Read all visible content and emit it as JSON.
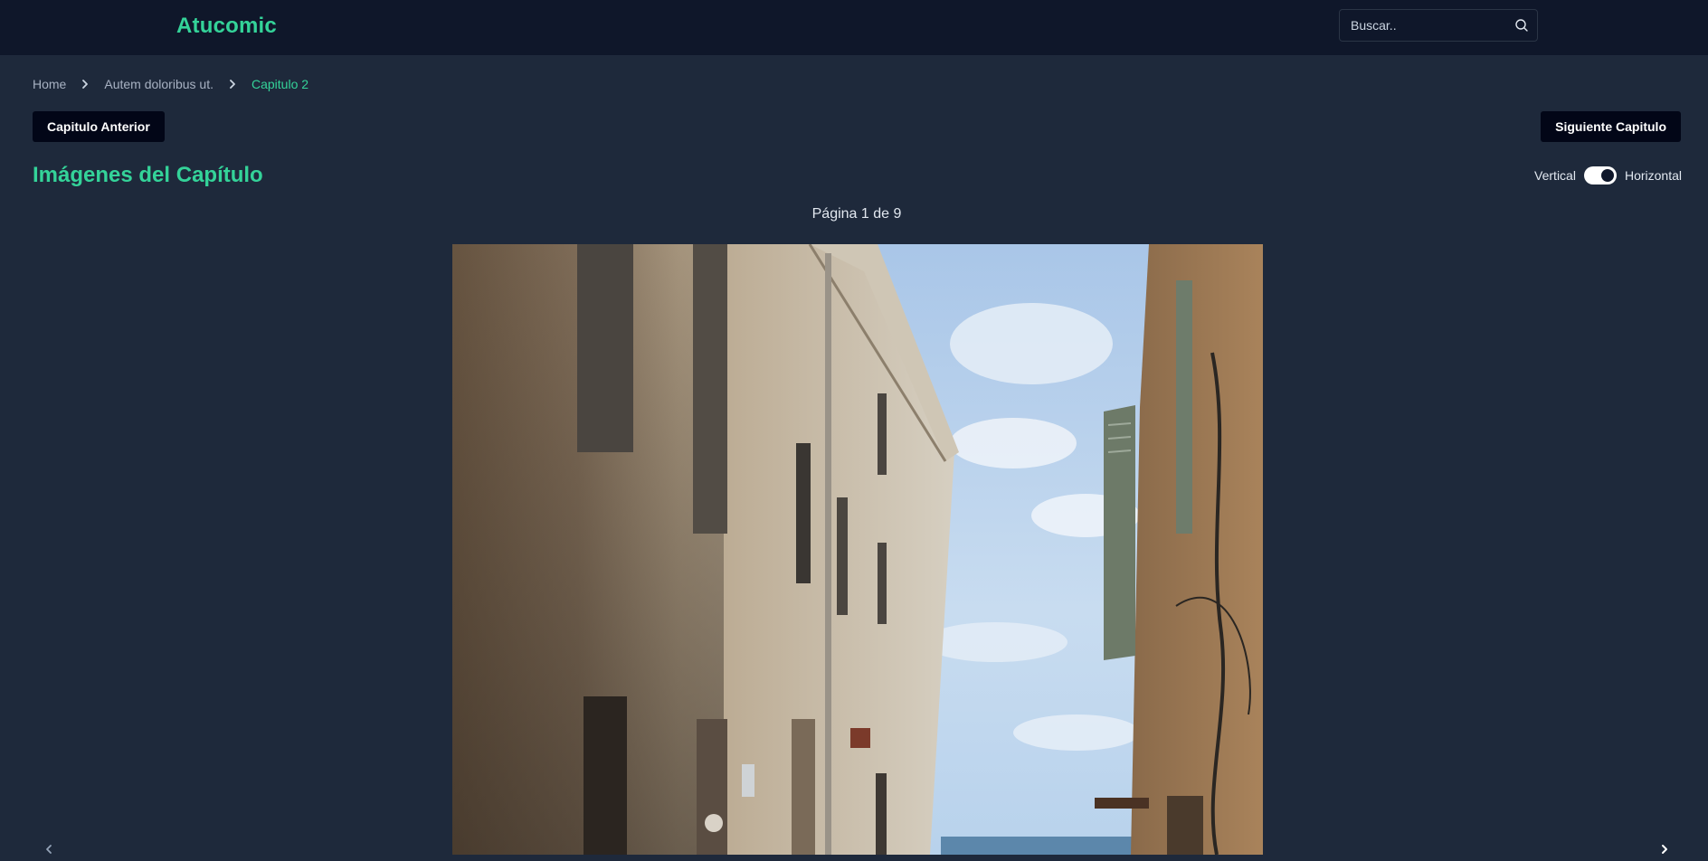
{
  "app": {
    "brand": "Atucomic"
  },
  "search": {
    "placeholder": "Buscar..",
    "icon": "search-icon"
  },
  "breadcrumb": {
    "items": [
      {
        "label": "Home"
      },
      {
        "label": "Autem doloribus ut."
      },
      {
        "label": "Capitulo 2"
      }
    ],
    "separator_icon": "chevron-right-icon"
  },
  "chapter_nav": {
    "prev_label": "Capitulo Anterior",
    "next_label": "Siguiente Capitulo"
  },
  "reader": {
    "section_title": "Imágenes del Capítulo",
    "mode_left_label": "Vertical",
    "mode_right_label": "Horizontal",
    "mode_selected": "Horizontal",
    "page_indicator": "Página 1 de 9",
    "image_alt": "Capitulo 2 - página 1",
    "prev_page_icon": "chevron-left-icon",
    "next_page_icon": "chevron-right-icon"
  },
  "colors": {
    "accent": "#34d399",
    "header_bg": "#0f172a",
    "page_bg": "#1e293b",
    "button_bg": "#020617"
  }
}
